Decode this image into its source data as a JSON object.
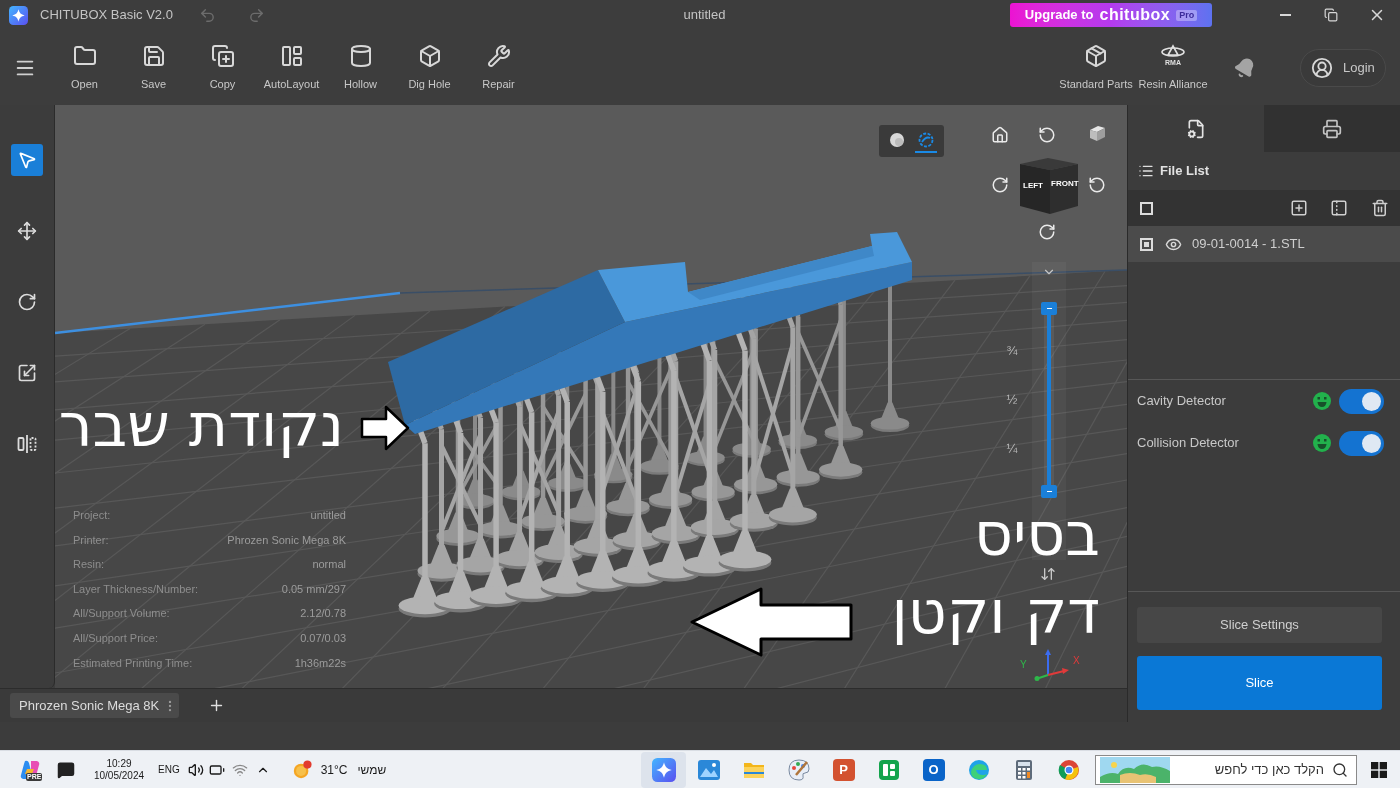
{
  "title_bar": {
    "app_title": "CHITUBOX Basic V2.0",
    "undo": {
      "disabled": true
    },
    "redo": {
      "disabled": true
    },
    "document_title": "untitled",
    "upgrade": {
      "label": "Upgrade to",
      "brand": "chitubox",
      "badge": "Pro"
    }
  },
  "toolbar": {
    "items": [
      {
        "label": "Open"
      },
      {
        "label": "Save"
      },
      {
        "label": "Copy"
      },
      {
        "label": "AutoLayout"
      },
      {
        "label": "Hollow"
      },
      {
        "label": "Dig Hole"
      },
      {
        "label": "Repair"
      }
    ],
    "right_items": [
      {
        "label": "Standard Parts"
      },
      {
        "label": "Resin Alliance",
        "logo_text": "RMA"
      }
    ],
    "login": "Login"
  },
  "tools": [
    {
      "selected": true
    },
    {
      "selected": false
    },
    {
      "selected": false
    },
    {
      "selected": false
    },
    {
      "selected": false
    }
  ],
  "viewport": {
    "render_modes": [
      {
        "selected": false
      },
      {
        "selected": true
      }
    ],
    "view_cube": {
      "left": "LEFT",
      "front": "FRONT"
    },
    "layer_slider": {
      "level": 1,
      "ticks": [
        "¾",
        "½",
        "¼"
      ]
    },
    "axes": {
      "x": "X",
      "y": "Y"
    },
    "info": [
      {
        "label": "Project:",
        "value": "untitled"
      },
      {
        "label": "Printer:",
        "value": "Phrozen Sonic Mega 8K"
      },
      {
        "label": "Resin:",
        "value": "normal"
      },
      {
        "label": "Layer Thickness/Number:",
        "value": "0.05 mm/297"
      },
      {
        "label": "All/Support Volume:",
        "value": "2.12/0.78"
      },
      {
        "label": "All/Support Price:",
        "value": "0.07/0.03"
      },
      {
        "label": "Estimated Printing Time:",
        "value": "1h36m22s"
      }
    ]
  },
  "annotations": [
    {
      "kind": "rightward",
      "lines": [
        "נקודת שבר"
      ]
    },
    {
      "kind": "leftward",
      "lines": [
        "בסיס",
        "דק וקטן"
      ]
    }
  ],
  "file_panel": {
    "tabs": [
      {
        "selected": true
      },
      {
        "selected": false
      }
    ],
    "title": "File List",
    "select_all": {
      "checked": false
    },
    "files": [
      {
        "name": "09-01-0014 - 1.STL",
        "selected": true,
        "checked": true,
        "visible": true
      }
    ],
    "detectors": [
      {
        "label": "Cavity Detector",
        "on": true
      },
      {
        "label": "Collision Detector",
        "on": true
      }
    ],
    "slice_settings": "Slice Settings",
    "slice": "Slice"
  },
  "printer_tabs": [
    {
      "label": "Phrozen Sonic Mega 8K",
      "selected": true
    }
  ],
  "taskbar": {
    "copilot_badge": "PRE",
    "time": "10:29",
    "date": "10/05/2024",
    "language": "ENG",
    "temperature": "31°C",
    "weather": "שמשי",
    "apps": [
      {
        "active": true
      },
      {
        "active": false
      },
      {
        "active": false
      },
      {
        "active": false
      },
      {
        "active": false,
        "glyph": "P"
      },
      {
        "active": false
      },
      {
        "active": false,
        "glyph": "O"
      },
      {
        "active": false
      },
      {
        "active": false
      },
      {
        "active": false
      }
    ],
    "search": {
      "placeholder": "הקלד כאן כדי לחפש"
    }
  }
}
